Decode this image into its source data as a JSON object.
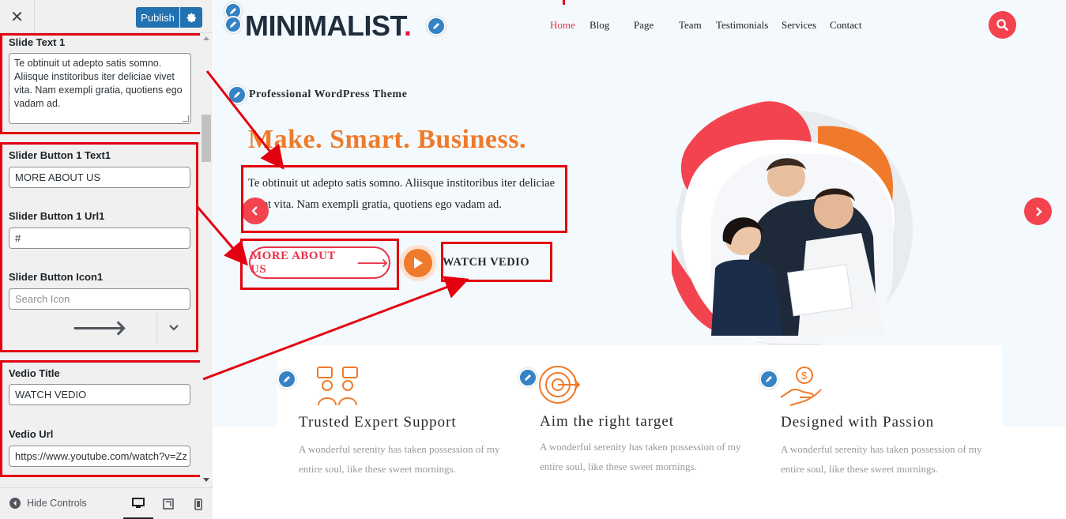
{
  "customizer": {
    "close_symbol": "✕",
    "publish_label": "Publish",
    "controls": {
      "slide_text_label": "Slide Text 1",
      "slide_text_value": "Te obtinuit ut adepto satis somno. Aliisque institoribus iter deliciae vivet vita. Nam exempli gratia, quotiens ego vadam ad.",
      "button_text_label": "Slider Button 1 Text1",
      "button_text_value": "MORE ABOUT US",
      "button_url_label": "Slider Button 1 Url1",
      "button_url_value": "#",
      "button_icon_label": "Slider Button Icon1",
      "button_icon_placeholder": "Search Icon",
      "button_icon_preview": "🡒",
      "video_title_label": "Vedio Title",
      "video_title_value": "WATCH VEDIO",
      "video_url_label": "Vedio Url",
      "video_url_value": "https://www.youtube.com/watch?v=Zz"
    },
    "footer": {
      "hide_controls_label": "Hide Controls"
    }
  },
  "site": {
    "logo_text": "MINIMALIST",
    "logo_dot": ".",
    "nav": [
      "Home",
      "Blog",
      "Page",
      "Team",
      "Testimonials",
      "Services",
      "Contact"
    ],
    "hero": {
      "subtitle": "Professional WordPress Theme",
      "title": "Make. Smart. Business.",
      "text": "Te obtinuit ut adepto satis somno. Aliisque institoribus iter deliciae vivet vita. Nam exempli gratia, quotiens ego vadam ad.",
      "button_label": "MORE ABOUT US",
      "button_arrow": "🡒",
      "video_label": "WATCH VEDIO"
    },
    "features": [
      {
        "title": "Trusted Expert Support",
        "desc": "A wonderful serenity has taken possession of my entire soul, like these sweet mornings.",
        "icon": "support-team-icon"
      },
      {
        "title": "Aim the right target",
        "desc": "A wonderful serenity has taken possession of my entire soul, like these sweet mornings.",
        "icon": "target-icon"
      },
      {
        "title": "Designed with Passion",
        "desc": "A wonderful serenity has taken possession of my entire soul, like these sweet mornings.",
        "icon": "money-hand-icon"
      }
    ]
  },
  "colors": {
    "accent_red": "#f2434f",
    "accent_orange": "#f07a2b",
    "publish_blue": "#2271b1",
    "annotation_red": "#e3000f"
  }
}
